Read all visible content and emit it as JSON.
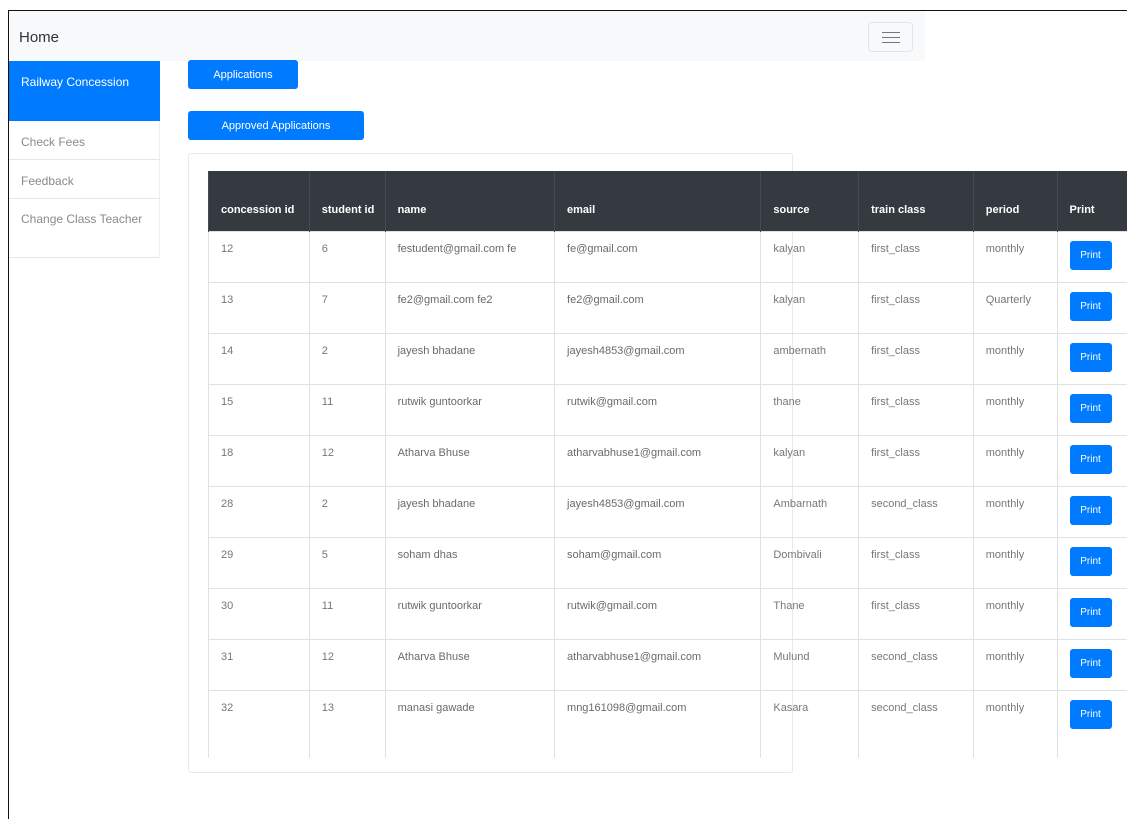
{
  "navbar": {
    "brand": "Home"
  },
  "sidebar": {
    "items": [
      {
        "label": "Railway Concession"
      },
      {
        "label": "Check Fees"
      },
      {
        "label": "Feedback"
      },
      {
        "label": "Change Class Teacher"
      }
    ]
  },
  "buttons": {
    "applications": "Applications",
    "approved": "Approved Applications"
  },
  "table": {
    "headers": {
      "concession_id": "concession id",
      "student_id": "student id",
      "name": "name",
      "email": "email",
      "source": "source",
      "train_class": "train class",
      "period": "period",
      "print": "Print"
    },
    "print_label": "Print",
    "rows": [
      {
        "concession_id": "12",
        "student_id": "6",
        "name": "festudent@gmail.com fe",
        "email": "fe@gmail.com",
        "source": "kalyan",
        "train_class": "first_class",
        "period": "monthly"
      },
      {
        "concession_id": "13",
        "student_id": "7",
        "name": "fe2@gmail.com fe2",
        "email": "fe2@gmail.com",
        "source": "kalyan",
        "train_class": "first_class",
        "period": "Quarterly"
      },
      {
        "concession_id": "14",
        "student_id": "2",
        "name": "jayesh bhadane",
        "email": "jayesh4853@gmail.com",
        "source": "ambernath",
        "train_class": "first_class",
        "period": "monthly"
      },
      {
        "concession_id": "15",
        "student_id": "11",
        "name": "rutwik guntoorkar",
        "email": "rutwik@gmail.com",
        "source": "thane",
        "train_class": "first_class",
        "period": "monthly"
      },
      {
        "concession_id": "18",
        "student_id": "12",
        "name": "Atharva Bhuse",
        "email": "atharvabhuse1@gmail.com",
        "source": "kalyan",
        "train_class": "first_class",
        "period": "monthly"
      },
      {
        "concession_id": "28",
        "student_id": "2",
        "name": "jayesh bhadane",
        "email": "jayesh4853@gmail.com",
        "source": "Ambarnath",
        "train_class": "second_class",
        "period": "monthly"
      },
      {
        "concession_id": "29",
        "student_id": "5",
        "name": "soham dhas",
        "email": "soham@gmail.com",
        "source": "Dombivali",
        "train_class": "first_class",
        "period": "monthly"
      },
      {
        "concession_id": "30",
        "student_id": "11",
        "name": "rutwik guntoorkar",
        "email": "rutwik@gmail.com",
        "source": "Thane",
        "train_class": "first_class",
        "period": "monthly"
      },
      {
        "concession_id": "31",
        "student_id": "12",
        "name": "Atharva Bhuse",
        "email": "atharvabhuse1@gmail.com",
        "source": "Mulund",
        "train_class": "second_class",
        "period": "monthly"
      },
      {
        "concession_id": "32",
        "student_id": "13",
        "name": "manasi gawade",
        "email": "mng161098@gmail.com",
        "source": "Kasara",
        "train_class": "second_class",
        "period": "monthly"
      }
    ]
  },
  "colors": {
    "primary": "#007bff",
    "table_header_bg": "#343a40",
    "navbar_bg": "#f8f9fa"
  }
}
